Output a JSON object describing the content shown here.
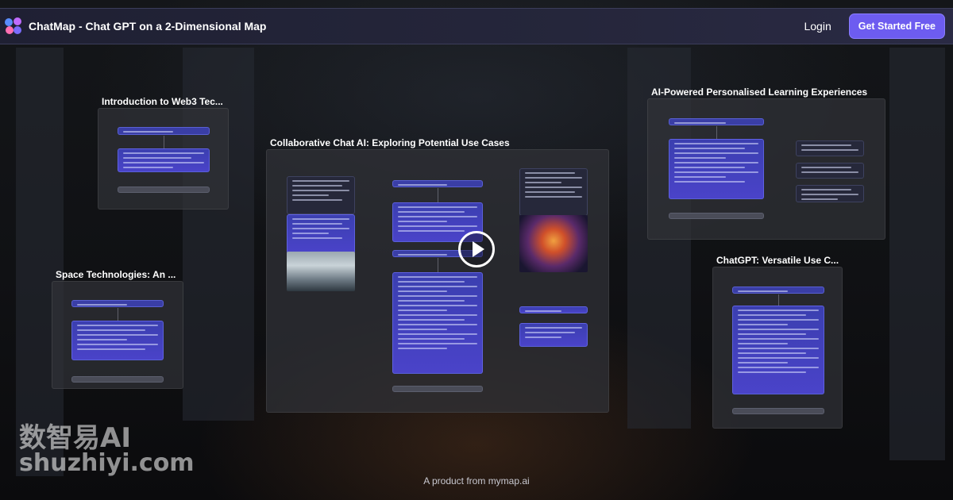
{
  "header": {
    "app_name": "ChatMap - Chat GPT on a 2-Dimensional Map",
    "login_label": "Login",
    "cta_label": "Get Started Free"
  },
  "cards": [
    {
      "title": "Introduction to Web3 Tec..."
    },
    {
      "title": "Collaborative Chat AI: Exploring Potential Use Cases"
    },
    {
      "title": "AI-Powered Personalised Learning Experiences"
    },
    {
      "title": "Space Technologies: An ..."
    },
    {
      "title": "ChatGPT: Versatile Use C..."
    }
  ],
  "watermark": {
    "line1": "数智易AI",
    "line2": "shuzhiyi.com"
  },
  "footer": {
    "prefix": "A product from",
    "link": "mymap.ai"
  },
  "colors": {
    "accent": "#6d5cf0",
    "node": "#4a43c9"
  },
  "icons": {
    "logo": "chatmap-logo-icon",
    "play": "play-icon"
  }
}
